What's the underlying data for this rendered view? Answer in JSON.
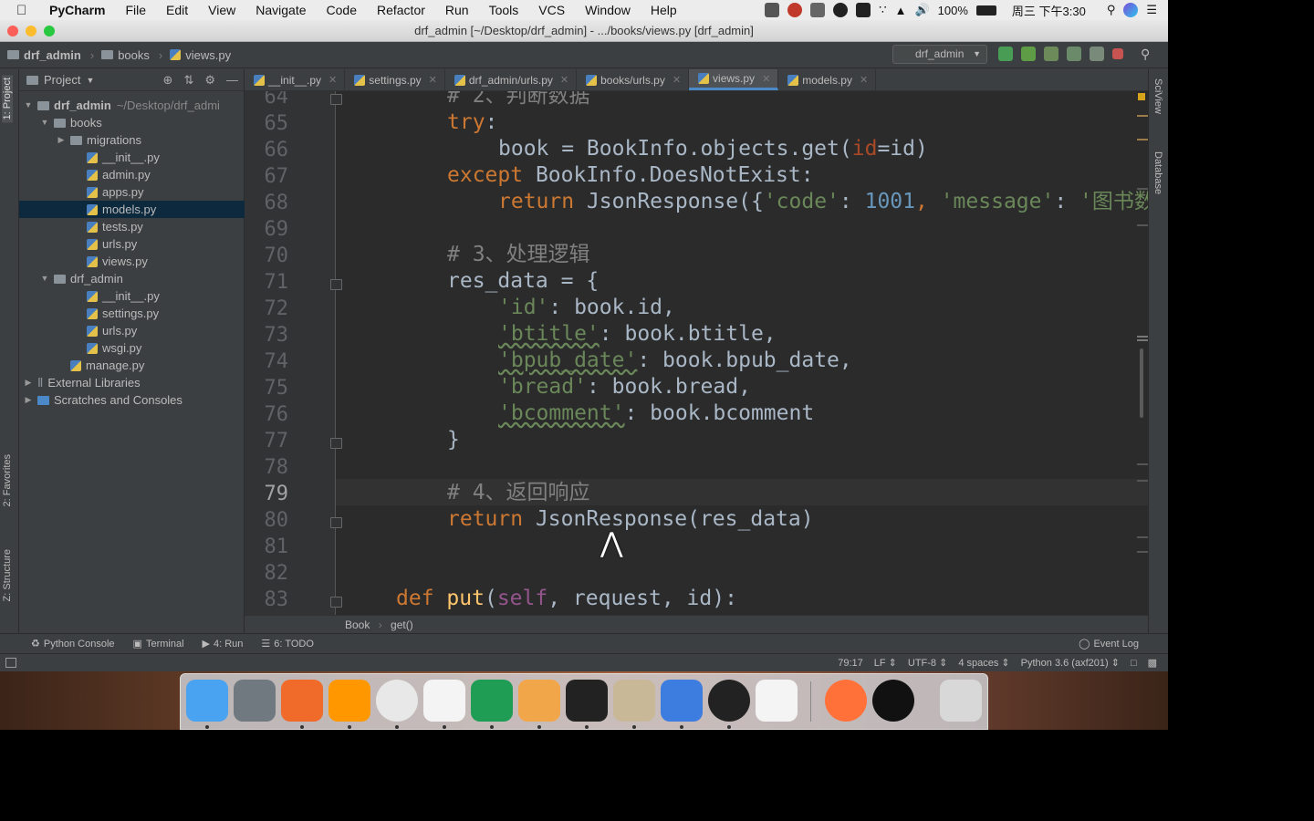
{
  "menubar": {
    "app": "PyCharm",
    "items": [
      "File",
      "Edit",
      "View",
      "Navigate",
      "Code",
      "Refactor",
      "Run",
      "Tools",
      "VCS",
      "Window",
      "Help"
    ],
    "battery": "100%",
    "clock": "周三 下午3:30"
  },
  "window": {
    "title": "drf_admin [~/Desktop/drf_admin] - .../books/views.py [drf_admin]"
  },
  "navbar": {
    "crumbs": [
      "drf_admin",
      "books",
      "views.py"
    ],
    "run_config": "drf_admin"
  },
  "project_panel": {
    "header": "Project",
    "tree": [
      {
        "label": "drf_admin",
        "suffix": "~/Desktop/drf_admi",
        "kind": "folder",
        "expanded": true
      },
      {
        "label": "books",
        "kind": "folder",
        "expanded": true
      },
      {
        "label": "migrations",
        "kind": "folder",
        "expanded": false
      },
      {
        "label": "__init__.py",
        "kind": "py"
      },
      {
        "label": "admin.py",
        "kind": "py"
      },
      {
        "label": "apps.py",
        "kind": "py"
      },
      {
        "label": "models.py",
        "kind": "py",
        "selected": true
      },
      {
        "label": "tests.py",
        "kind": "py"
      },
      {
        "label": "urls.py",
        "kind": "py"
      },
      {
        "label": "views.py",
        "kind": "py"
      },
      {
        "label": "drf_admin",
        "kind": "folder",
        "expanded": true
      },
      {
        "label": "__init__.py",
        "kind": "py"
      },
      {
        "label": "settings.py",
        "kind": "py"
      },
      {
        "label": "urls.py",
        "kind": "py"
      },
      {
        "label": "wsgi.py",
        "kind": "py"
      },
      {
        "label": "manage.py",
        "kind": "py"
      },
      {
        "label": "External Libraries",
        "kind": "lib",
        "expanded": false
      },
      {
        "label": "Scratches and Consoles",
        "kind": "scratch",
        "expanded": false
      }
    ]
  },
  "side_tabs": {
    "project": "1: Project",
    "favorites": "2: Favorites",
    "structure": "Z: Structure",
    "sciview": "SciView",
    "database": "Database"
  },
  "tabs": [
    {
      "label": "__init__.py",
      "active": false
    },
    {
      "label": "settings.py",
      "active": false
    },
    {
      "label": "drf_admin/urls.py",
      "active": false
    },
    {
      "label": "books/urls.py",
      "active": false
    },
    {
      "label": "views.py",
      "active": true
    },
    {
      "label": "models.py",
      "active": false
    }
  ],
  "editor": {
    "current_line": "79",
    "lines": [
      "64",
      "65",
      "66",
      "67",
      "68",
      "69",
      "70",
      "71",
      "72",
      "73",
      "74",
      "75",
      "76",
      "77",
      "78",
      "79",
      "80",
      "81",
      "82",
      "83"
    ],
    "code": {
      "l64": "# 2、判断数据",
      "l65_kw": "try",
      "l66_a": "book = BookInfo.objects.get(",
      "l66_param": "id",
      "l66_b": "=id)",
      "l67_kw": "except",
      "l67_rest": " BookInfo.DoesNotExist:",
      "l68_kw": "return",
      "l68_a": " JsonResponse({",
      "l68_s1": "'code'",
      "l68_num": "1001",
      "l68_s2": "'message'",
      "l68_s3": "'图书数据不存在'",
      "l70": "# 3、处理逻辑",
      "l71": "res_data = {",
      "l72_key": "'id'",
      "l72_val": ": book.id,",
      "l73_key": "'btitle'",
      "l73_val": ": book.btitle,",
      "l74_key": "'bpub_date'",
      "l74_val": ": book.bpub_date,",
      "l75_key": "'bread'",
      "l75_val": ": book.bread,",
      "l76_key": "'bcomment'",
      "l76_val": ": book.bcomment",
      "l77": "}",
      "l79": "# 4、返回响应",
      "l80_kw": "return",
      "l80_rest": " JsonResponse(res_data)",
      "l83_kw": "def",
      "l83_fn": "put",
      "l83_self": "self",
      "l83_rest": ", request, id):"
    }
  },
  "breadcrumb_bar": [
    "Book",
    "get()"
  ],
  "tool_windows": {
    "python_console": "Python Console",
    "terminal": "Terminal",
    "run": "4: Run",
    "todo": "6: TODO",
    "event_log": "Event Log"
  },
  "status": {
    "position": "79:17",
    "line_sep": "LF",
    "encoding": "UTF-8",
    "indent": "4 spaces",
    "interpreter": "Python 3.6 (axf201)"
  },
  "dock": [
    "Finder",
    "Launchpad",
    "Sketchbook",
    "Sublime Text",
    "Chrome",
    "Typora",
    "PyCharm",
    "Instastats",
    "Terminal",
    "Script Editor",
    "Screens",
    "OBS",
    "Keynote",
    "Firefox",
    "Infuse",
    "Trash"
  ],
  "colors": {
    "editor_bg": "#2b2b2b",
    "keyword": "#cc7832",
    "string": "#6a8759",
    "number": "#6897bb",
    "comment": "#808080",
    "selection": "#0d293e"
  }
}
